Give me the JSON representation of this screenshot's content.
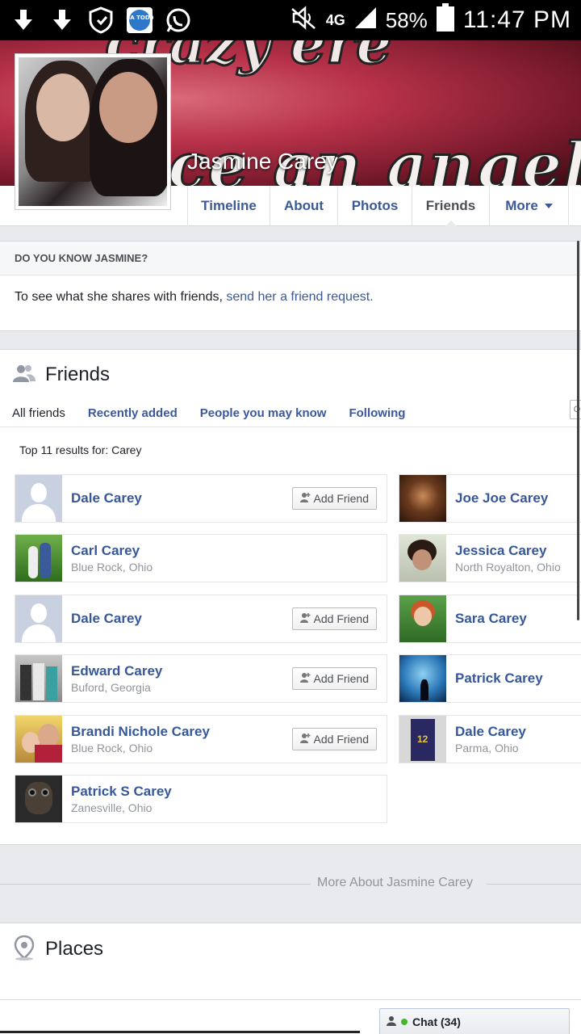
{
  "status_bar": {
    "network": "4G",
    "battery": "58%",
    "time": "11:47 PM",
    "notif_icons": [
      "download-icon",
      "download-icon",
      "shield-icon",
      "usa-today-icon",
      "whatsapp-icon"
    ],
    "usa_today_label": "USA TODAY"
  },
  "profile": {
    "name": "Jasmine Carey",
    "cover_text": "once an angel"
  },
  "tabs": [
    {
      "label": "Timeline"
    },
    {
      "label": "About"
    },
    {
      "label": "Photos"
    },
    {
      "label": "Friends"
    },
    {
      "label": "More"
    }
  ],
  "know": {
    "heading": "DO YOU KNOW JASMINE?",
    "text": "To see what she shares with friends,",
    "link": "send her a friend request."
  },
  "friends": {
    "title": "Friends",
    "subtabs": [
      "All friends",
      "Recently added",
      "People you may know",
      "Following"
    ],
    "results_label": "Top 11 results for: Carey",
    "search_stub": "Q",
    "add_label": "Add Friend",
    "list": [
      {
        "name": "Dale Carey",
        "location": "",
        "add": true
      },
      {
        "name": "Joe Joe Carey",
        "location": "",
        "add": false
      },
      {
        "name": "Carl Carey",
        "location": "Blue Rock, Ohio",
        "add": false
      },
      {
        "name": "Jessica Carey",
        "location": "North Royalton, Ohio",
        "add": false
      },
      {
        "name": "Dale Carey",
        "location": "",
        "add": true
      },
      {
        "name": "Sara Carey",
        "location": "",
        "add": false
      },
      {
        "name": "Edward Carey",
        "location": "Buford, Georgia",
        "add": true
      },
      {
        "name": "Patrick Carey",
        "location": "",
        "add": false
      },
      {
        "name": "Brandi Nichole Carey",
        "location": "Blue Rock, Ohio",
        "add": true
      },
      {
        "name": "Dale Carey",
        "location": "Parma, Ohio",
        "add": false
      },
      {
        "name": "Patrick S Carey",
        "location": "Zanesville, Ohio",
        "add": false
      }
    ]
  },
  "more_about": "More About Jasmine Carey",
  "places": {
    "title": "Places"
  },
  "chat": {
    "label": "Chat (34)"
  },
  "colors": {
    "link": "#365899",
    "page_bg": "#e9eaed",
    "online": "#42b72a"
  }
}
